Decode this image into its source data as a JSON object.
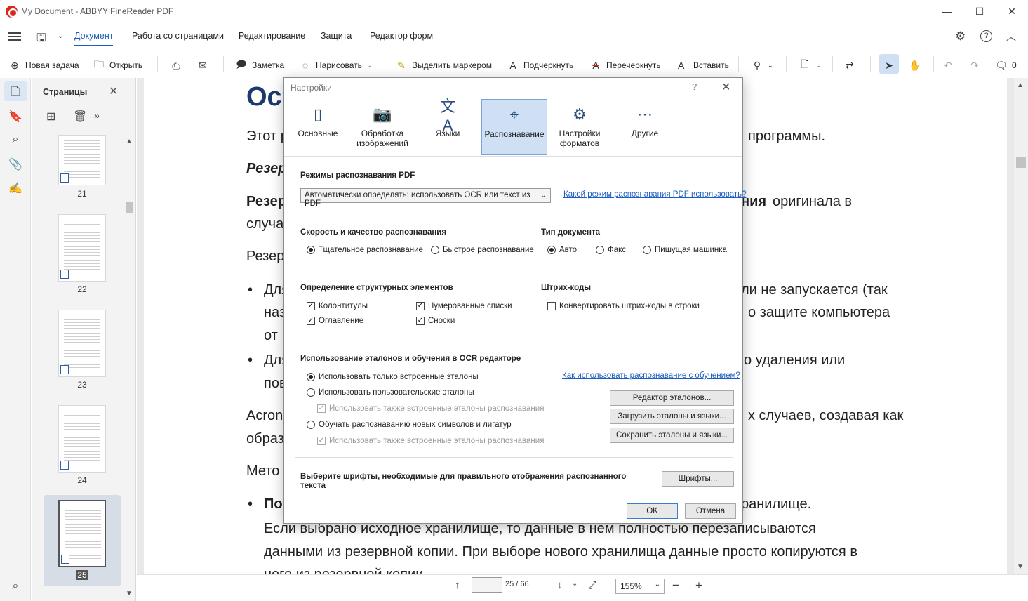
{
  "window": {
    "title": "My Document - ABBYY FineReader PDF",
    "minimize": "—",
    "maximize": "☐",
    "close": "✕"
  },
  "menu": {
    "items": [
      "Документ",
      "Работа со страницами",
      "Редактирование",
      "Защита",
      "Редактор форм"
    ]
  },
  "toolbar": {
    "new_task": "Новая задача",
    "open": "Открыть",
    "note": "Заметка",
    "draw": "Нарисовать",
    "highlight": "Выделить маркером",
    "underline": "Подчеркнуть",
    "strikeout": "Перечеркнуть",
    "insert": "Вставить",
    "comments_count": "0"
  },
  "pages_panel": {
    "title": "Страницы",
    "thumbs": [
      "21",
      "22",
      "23",
      "24",
      "25"
    ],
    "selected": "25"
  },
  "document": {
    "heading": "Осн",
    "lines": [
      "Этот р",
      "программы.",
      "Резер",
      "Резер",
      "ния",
      "оригинала в",
      "случа",
      "Резер",
      "Для",
      "ли не запускается (так",
      "наз",
      "о защите компьютера",
      "от ",
      "Для",
      "о удаления или",
      "пов",
      "Acron",
      "х случаев, создавая как",
      "образ",
      "Мето",
      "По",
      "ранилище.",
      "Если выбрано исходное хранилище, то данные в нем полностью перезаписываются",
      "данными из резервной копии. При выборе нового хранилища данные просто копируются в",
      "него из резервной копии."
    ]
  },
  "bottom": {
    "page_current": "25",
    "page_total": "66",
    "zoom": "155%"
  },
  "dialog": {
    "title": "Настройки",
    "help": "?",
    "close": "✕",
    "tabs": [
      {
        "label": "Основные",
        "icon": "phone-settings-icon"
      },
      {
        "label": "Обработка изображений",
        "icon": "camera-icon"
      },
      {
        "label": "Языки",
        "icon": "language-icon"
      },
      {
        "label": "Распознавание",
        "icon": "recognition-icon"
      },
      {
        "label": "Настройки форматов",
        "icon": "file-gear-icon"
      },
      {
        "label": "Другие",
        "icon": "more-icon"
      }
    ],
    "active_tab": "Распознавание",
    "pdf_mode": {
      "title": "Режимы распознавания PDF",
      "selected": "Автоматически определять: использовать OCR или текст из PDF",
      "help_link": "Какой режим распознавания PDF использовать?"
    },
    "speed": {
      "title": "Скорость и качество распознавания",
      "options": [
        "Тщательное распознавание",
        "Быстрое распознавание"
      ],
      "selected": 0
    },
    "doc_type": {
      "title": "Тип документа",
      "options": [
        "Авто",
        "Факс",
        "Пишущая машинка"
      ],
      "selected": 0
    },
    "structure": {
      "title": "Определение структурных элементов",
      "items": [
        {
          "label": "Колонтитулы",
          "checked": true
        },
        {
          "label": "Нумерованные списки",
          "checked": true
        },
        {
          "label": "Оглавление",
          "checked": true
        },
        {
          "label": "Сноски",
          "checked": true
        }
      ]
    },
    "barcodes": {
      "title": "Штрих-коды",
      "option": "Конвертировать штрих-коды в строки",
      "checked": false
    },
    "training": {
      "title": "Использование эталонов и обучения в OCR редакторе",
      "help_link": "Как использовать распознавание с обучением?",
      "opt1": "Использовать только встроенные эталоны",
      "opt2": "Использовать пользовательские эталоны",
      "opt2_sub": "Использовать также встроенные эталоны распознавания",
      "opt3": "Обучать распознаванию новых символов и лигатур",
      "opt3_sub": "Использовать также встроенные эталоны распознавания",
      "btn_editor": "Редактор эталонов...",
      "btn_load": "Загрузить эталоны и языки...",
      "btn_save": "Сохранить эталоны и языки..."
    },
    "fonts": {
      "title": "Выберите шрифты, необходимые для правильного отображения распознанного текста",
      "button": "Шрифты..."
    },
    "ok": "OK",
    "cancel": "Отмена"
  }
}
